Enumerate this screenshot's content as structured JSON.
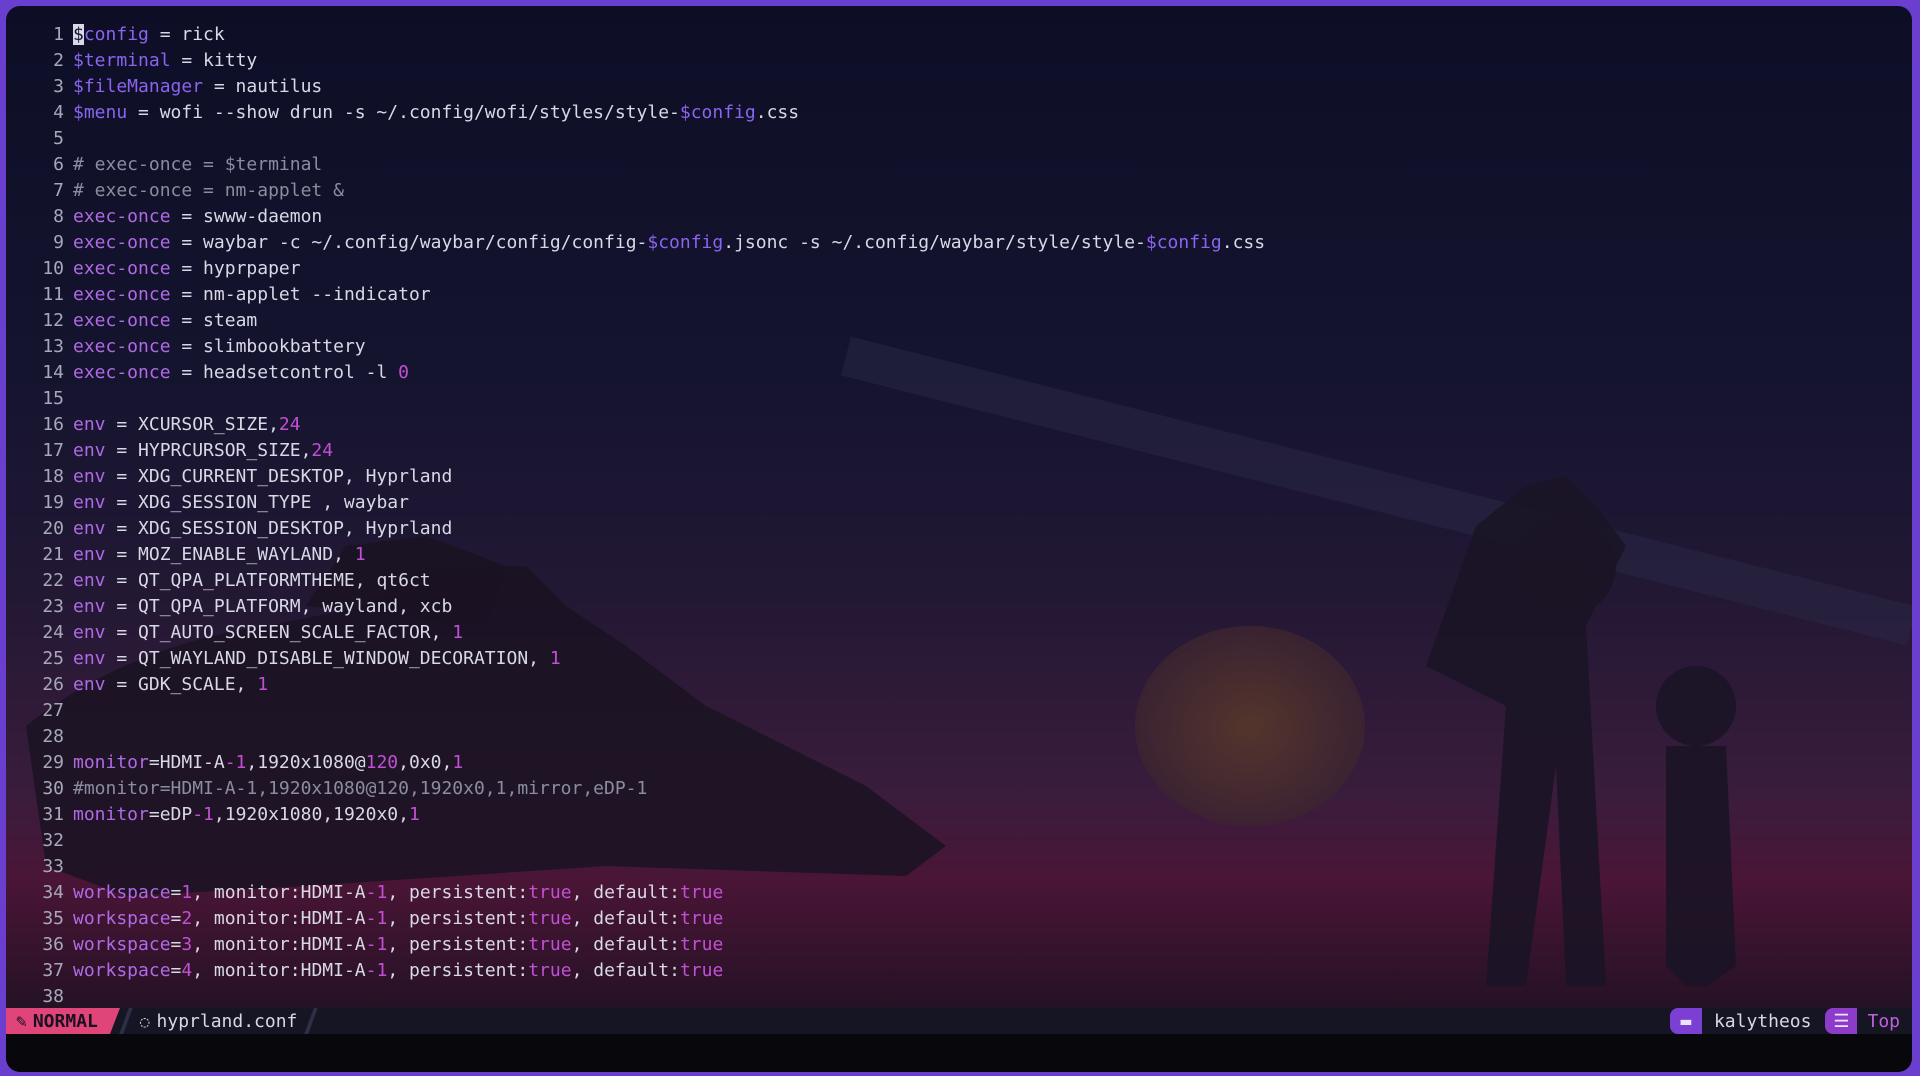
{
  "editor": {
    "cursor_char": "$",
    "lines": [
      {
        "num": "1",
        "segs": [
          [
            "v",
            "config"
          ],
          [
            "t",
            " = rick"
          ]
        ]
      },
      {
        "num": "2",
        "segs": [
          [
            "v",
            "$terminal"
          ],
          [
            "t",
            " = kitty"
          ]
        ]
      },
      {
        "num": "3",
        "segs": [
          [
            "v",
            "$fileManager"
          ],
          [
            "t",
            " = nautilus"
          ]
        ]
      },
      {
        "num": "4",
        "segs": [
          [
            "v",
            "$menu"
          ],
          [
            "t",
            " = wofi --show drun -s ~/.config/wofi/styles/style-"
          ],
          [
            "v",
            "$config"
          ],
          [
            "t",
            ".css"
          ]
        ]
      },
      {
        "num": "5",
        "segs": []
      },
      {
        "num": "6",
        "segs": [
          [
            "c",
            "# exec-once = $terminal"
          ]
        ]
      },
      {
        "num": "7",
        "segs": [
          [
            "c",
            "# exec-once = nm-applet &"
          ]
        ]
      },
      {
        "num": "8",
        "segs": [
          [
            "k",
            "exec-once"
          ],
          [
            "t",
            " = swww-daemon"
          ]
        ]
      },
      {
        "num": "9",
        "segs": [
          [
            "k",
            "exec-once"
          ],
          [
            "t",
            " = waybar -c ~/.config/waybar/config/config-"
          ],
          [
            "v",
            "$config"
          ],
          [
            "t",
            ".jsonc -s ~/.config/waybar/style/style-"
          ],
          [
            "v",
            "$config"
          ],
          [
            "t",
            ".css"
          ]
        ]
      },
      {
        "num": "10",
        "segs": [
          [
            "k",
            "exec-once"
          ],
          [
            "t",
            " = hyprpaper"
          ]
        ]
      },
      {
        "num": "11",
        "segs": [
          [
            "k",
            "exec-once"
          ],
          [
            "t",
            " = nm-applet --indicator"
          ]
        ]
      },
      {
        "num": "12",
        "segs": [
          [
            "k",
            "exec-once"
          ],
          [
            "t",
            " = steam"
          ]
        ]
      },
      {
        "num": "13",
        "segs": [
          [
            "k",
            "exec-once"
          ],
          [
            "t",
            " = slimbookbattery"
          ]
        ]
      },
      {
        "num": "14",
        "segs": [
          [
            "k",
            "exec-once"
          ],
          [
            "t",
            " = headsetcontrol -l "
          ],
          [
            "n",
            "0"
          ]
        ]
      },
      {
        "num": "15",
        "segs": []
      },
      {
        "num": "16",
        "segs": [
          [
            "k",
            "env"
          ],
          [
            "t",
            " = XCURSOR_SIZE,"
          ],
          [
            "n",
            "24"
          ]
        ]
      },
      {
        "num": "17",
        "segs": [
          [
            "k",
            "env"
          ],
          [
            "t",
            " = HYPRCURSOR_SIZE,"
          ],
          [
            "n",
            "24"
          ]
        ]
      },
      {
        "num": "18",
        "segs": [
          [
            "k",
            "env"
          ],
          [
            "t",
            " = XDG_CURRENT_DESKTOP, Hyprland"
          ]
        ]
      },
      {
        "num": "19",
        "segs": [
          [
            "k",
            "env"
          ],
          [
            "t",
            " = XDG_SESSION_TYPE , waybar"
          ]
        ]
      },
      {
        "num": "20",
        "segs": [
          [
            "k",
            "env"
          ],
          [
            "t",
            " = XDG_SESSION_DESKTOP, Hyprland"
          ]
        ]
      },
      {
        "num": "21",
        "segs": [
          [
            "k",
            "env"
          ],
          [
            "t",
            " = MOZ_ENABLE_WAYLAND, "
          ],
          [
            "n",
            "1"
          ]
        ]
      },
      {
        "num": "22",
        "segs": [
          [
            "k",
            "env"
          ],
          [
            "t",
            " = QT_QPA_PLATFORMTHEME, qt6ct"
          ]
        ]
      },
      {
        "num": "23",
        "segs": [
          [
            "k",
            "env"
          ],
          [
            "t",
            " = QT_QPA_PLATFORM, wayland, xcb"
          ]
        ]
      },
      {
        "num": "24",
        "segs": [
          [
            "k",
            "env"
          ],
          [
            "t",
            " = QT_AUTO_SCREEN_SCALE_FACTOR, "
          ],
          [
            "n",
            "1"
          ]
        ]
      },
      {
        "num": "25",
        "segs": [
          [
            "k",
            "env"
          ],
          [
            "t",
            " = QT_WAYLAND_DISABLE_WINDOW_DECORATION, "
          ],
          [
            "n",
            "1"
          ]
        ]
      },
      {
        "num": "26",
        "segs": [
          [
            "k",
            "env"
          ],
          [
            "t",
            " = GDK_SCALE, "
          ],
          [
            "n",
            "1"
          ]
        ]
      },
      {
        "num": "27",
        "segs": []
      },
      {
        "num": "28",
        "segs": []
      },
      {
        "num": "29",
        "segs": [
          [
            "k",
            "monitor"
          ],
          [
            "t",
            "=HDMI-A"
          ],
          [
            "n",
            "-1"
          ],
          [
            "t",
            ",1920x1080@"
          ],
          [
            "n",
            "120"
          ],
          [
            "t",
            ",0x0,"
          ],
          [
            "n",
            "1"
          ]
        ]
      },
      {
        "num": "30",
        "segs": [
          [
            "c",
            "#monitor=HDMI-A-1,1920x1080@120,1920x0,1,mirror,eDP-1"
          ]
        ]
      },
      {
        "num": "31",
        "segs": [
          [
            "k",
            "monitor"
          ],
          [
            "t",
            "=eDP"
          ],
          [
            "n",
            "-1"
          ],
          [
            "t",
            ",1920x1080,1920x0,"
          ],
          [
            "n",
            "1"
          ]
        ]
      },
      {
        "num": "32",
        "segs": []
      },
      {
        "num": "33",
        "segs": []
      },
      {
        "num": "34",
        "segs": [
          [
            "k",
            "workspace"
          ],
          [
            "t",
            "="
          ],
          [
            "n",
            "1"
          ],
          [
            "t",
            ", monitor:HDMI-A"
          ],
          [
            "n",
            "-1"
          ],
          [
            "t",
            ", persistent:"
          ],
          [
            "n",
            "true"
          ],
          [
            "t",
            ", default:"
          ],
          [
            "n",
            "true"
          ]
        ]
      },
      {
        "num": "35",
        "segs": [
          [
            "k",
            "workspace"
          ],
          [
            "t",
            "="
          ],
          [
            "n",
            "2"
          ],
          [
            "t",
            ", monitor:HDMI-A"
          ],
          [
            "n",
            "-1"
          ],
          [
            "t",
            ", persistent:"
          ],
          [
            "n",
            "true"
          ],
          [
            "t",
            ", default:"
          ],
          [
            "n",
            "true"
          ]
        ]
      },
      {
        "num": "36",
        "segs": [
          [
            "k",
            "workspace"
          ],
          [
            "t",
            "="
          ],
          [
            "n",
            "3"
          ],
          [
            "t",
            ", monitor:HDMI-A"
          ],
          [
            "n",
            "-1"
          ],
          [
            "t",
            ", persistent:"
          ],
          [
            "n",
            "true"
          ],
          [
            "t",
            ", default:"
          ],
          [
            "n",
            "true"
          ]
        ]
      },
      {
        "num": "37",
        "segs": [
          [
            "k",
            "workspace"
          ],
          [
            "t",
            "="
          ],
          [
            "n",
            "4"
          ],
          [
            "t",
            ", monitor:HDMI-A"
          ],
          [
            "n",
            "-1"
          ],
          [
            "t",
            ", persistent:"
          ],
          [
            "n",
            "true"
          ],
          [
            "t",
            ", default:"
          ],
          [
            "n",
            "true"
          ]
        ]
      },
      {
        "num": "38",
        "segs": []
      }
    ]
  },
  "statusline": {
    "mode": "NORMAL",
    "mode_icon": "edit-pencil-icon",
    "filename": "hyprland.conf",
    "file_icon": "drop-icon",
    "directory": "kalytheos",
    "directory_icon": "folder-icon",
    "position": "Top",
    "position_icon": "lines-icon"
  },
  "colors": {
    "keyword": "#b06ae6",
    "variable": "#8a64ee",
    "number": "#c34fd6",
    "comment": "#8c8ca0",
    "mode_bg": "#e0457a",
    "frame_border": "#6a3fd0"
  }
}
